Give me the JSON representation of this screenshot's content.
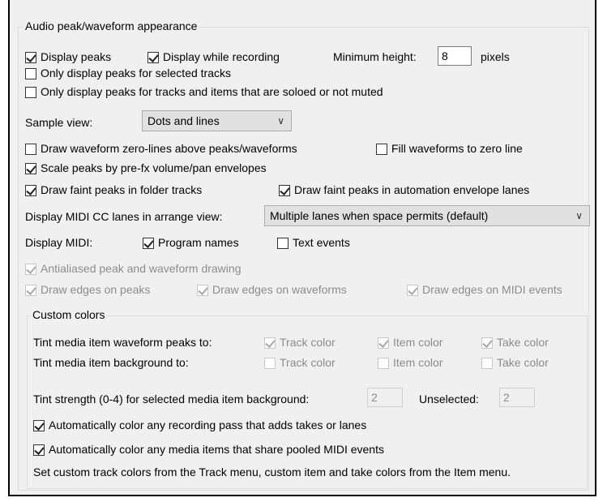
{
  "peaks_group": {
    "title": "Audio peak/waveform appearance",
    "display_peaks": "Display peaks",
    "display_while_recording": "Display while recording",
    "min_height_label": "Minimum height:",
    "min_height_value": "8",
    "pixels_label": "pixels",
    "only_selected": "Only display peaks for selected tracks",
    "only_soloed": "Only display peaks for tracks and items that are soloed or not muted",
    "sample_view_label": "Sample view:",
    "sample_view_value": "Dots and lines",
    "draw_zero_lines": "Draw waveform zero-lines above peaks/waveforms",
    "fill_to_zero": "Fill waveforms to zero line",
    "scale_peaks": "Scale peaks by pre-fx volume/pan envelopes",
    "faint_folder": "Draw faint peaks in folder tracks",
    "faint_automation": "Draw faint peaks in automation envelope lanes",
    "midi_cc_label": "Display MIDI CC lanes in arrange view:",
    "midi_cc_value": "Multiple lanes when space permits (default)",
    "display_midi_label": "Display MIDI:",
    "program_names": "Program names",
    "text_events": "Text events",
    "antialiased": "Antialiased peak and waveform drawing",
    "edges_peaks": "Draw edges on peaks",
    "edges_waveforms": "Draw edges on waveforms",
    "edges_midi": "Draw edges on MIDI events"
  },
  "custom_colors": {
    "title": "Custom colors",
    "tint_peaks_label": "Tint media item waveform peaks to:",
    "tint_bg_label": "Tint media item background to:",
    "track_color": "Track color",
    "item_color": "Item color",
    "take_color": "Take color",
    "tint_strength_label": "Tint strength (0-4) for selected media item background:",
    "tint_strength_value": "2",
    "unselected_label": "Unselected:",
    "unselected_value": "2",
    "auto_color_recording": "Automatically color any recording pass that adds takes or lanes",
    "auto_color_pooled": "Automatically color any media items that share pooled MIDI events",
    "footer_note": "Set custom track colors from the Track menu, custom item and take colors from the Item menu."
  }
}
